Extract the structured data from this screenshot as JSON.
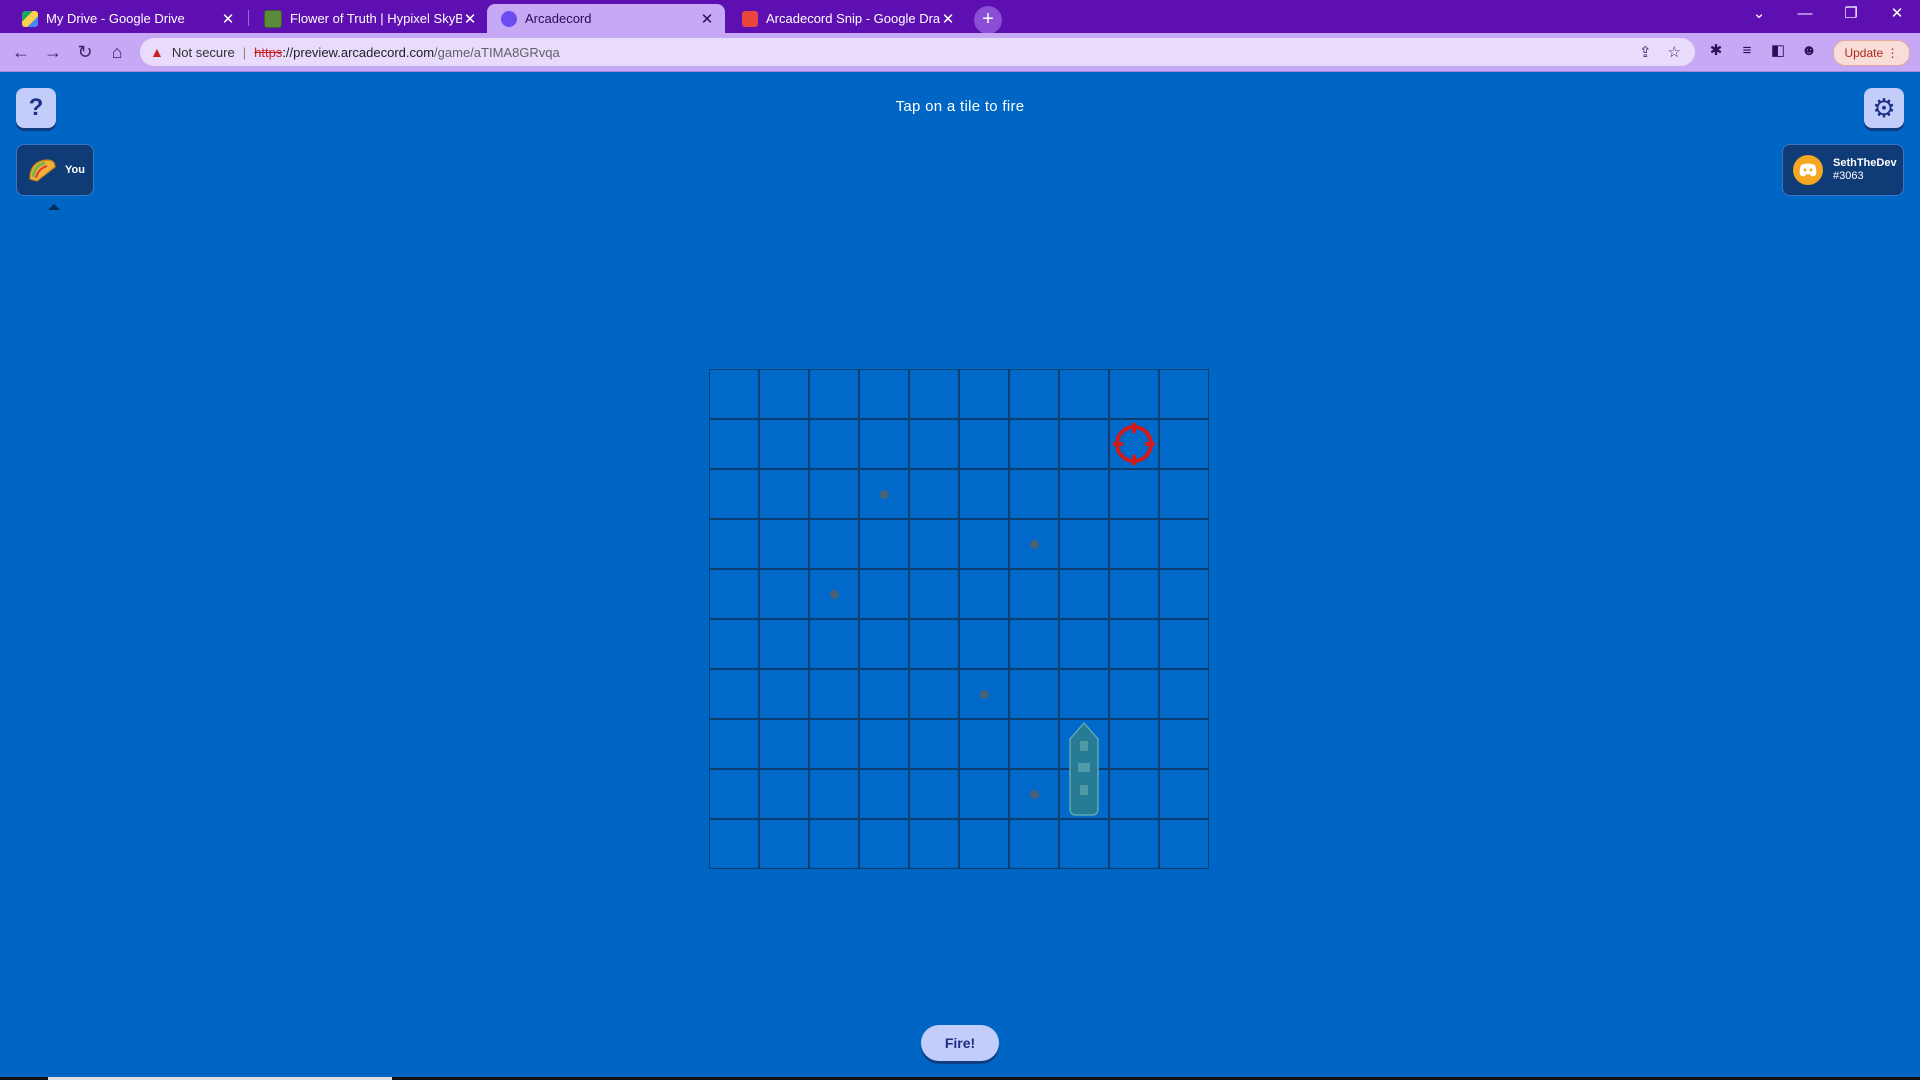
{
  "browser": {
    "tabs": [
      {
        "title": "My Drive - Google Drive",
        "favicon": "google-drive-icon",
        "active": false
      },
      {
        "title": "Flower of Truth | Hypixel SkyBlock",
        "favicon": "minecraft-block-icon",
        "active": false
      },
      {
        "title": "Arcadecord",
        "favicon": "arcadecord-icon",
        "active": true
      },
      {
        "title": "Arcadecord Snip - Google Drawings",
        "favicon": "google-drawings-icon",
        "active": false
      }
    ],
    "security_label": "Not secure",
    "url_scheme": "https",
    "url_host": "://preview.arcadecord.com",
    "url_path": "/game/aTIMA8GRvqa",
    "update_label": "Update",
    "accent": "#5e0fb1"
  },
  "game": {
    "instruction": "Tap on a tile to fire",
    "help_label": "?",
    "player": {
      "name": "You",
      "avatar": "taco-icon"
    },
    "opponent": {
      "name": "SethTheDev",
      "tag": "#3063",
      "avatar": "discord-icon"
    },
    "fire_label": "Fire!",
    "grid": {
      "rows": 10,
      "cols": 10,
      "misses": [
        {
          "row": 2,
          "col": 3
        },
        {
          "row": 3,
          "col": 6
        },
        {
          "row": 4,
          "col": 2
        },
        {
          "row": 6,
          "col": 5
        },
        {
          "row": 8,
          "col": 6
        }
      ],
      "target": {
        "row": 1,
        "col": 8
      },
      "ship": {
        "col": 7,
        "row_start": 7,
        "length": 2,
        "orientation": "vertical"
      }
    },
    "colors": {
      "background": "#0066c6",
      "target": "#d11a1a",
      "button": "#c3cdfa"
    }
  }
}
